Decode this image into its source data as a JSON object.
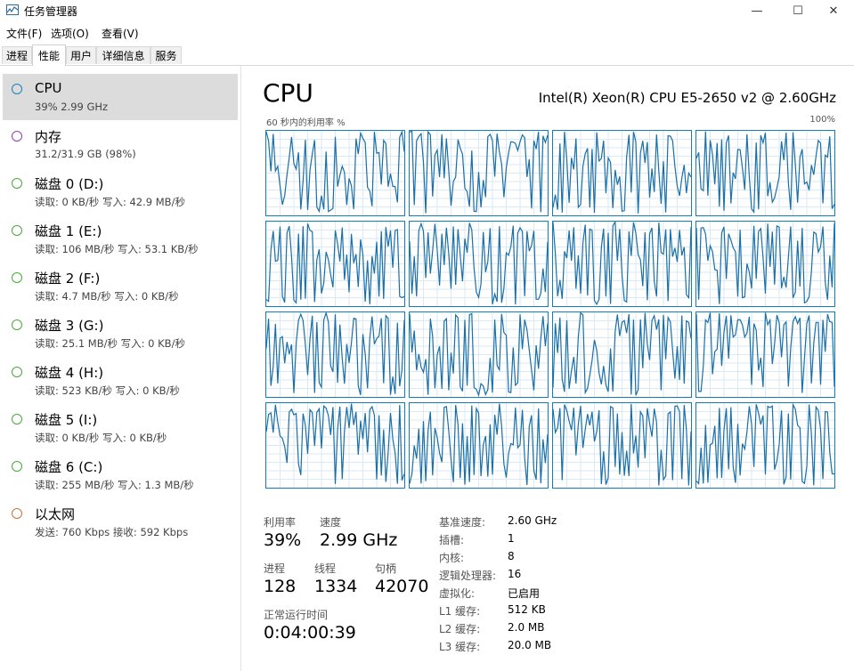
{
  "window": {
    "title": "任务管理器",
    "minimize_glyph": "—",
    "maximize_glyph": "☐",
    "close_glyph": "✕"
  },
  "menu": [
    "文件(F)",
    "选项(O)",
    "查看(V)"
  ],
  "tabs": [
    {
      "label": "进程",
      "active": false
    },
    {
      "label": "性能",
      "active": true
    },
    {
      "label": "用户",
      "active": false
    },
    {
      "label": "详细信息",
      "active": false
    },
    {
      "label": "服务",
      "active": false
    }
  ],
  "sidebar": {
    "items": [
      {
        "title": "CPU",
        "sub": "39% 2.99 GHz",
        "color": "#1a7fc1",
        "selected": true
      },
      {
        "title": "内存",
        "sub": "31.2/31.9 GB (98%)",
        "color": "#8e3fb3",
        "selected": false
      },
      {
        "title": "磁盘 0 (D:)",
        "sub": "读取: 0 KB/秒 写入: 42.9 MB/秒",
        "color": "#4aa73a",
        "selected": false
      },
      {
        "title": "磁盘 1 (E:)",
        "sub": "读取: 106 MB/秒 写入: 53.1 KB/秒",
        "color": "#4aa73a",
        "selected": false
      },
      {
        "title": "磁盘 2 (F:)",
        "sub": "读取: 4.7 MB/秒 写入: 0 KB/秒",
        "color": "#4aa73a",
        "selected": false
      },
      {
        "title": "磁盘 3 (G:)",
        "sub": "读取: 25.1 MB/秒 写入: 0 KB/秒",
        "color": "#4aa73a",
        "selected": false
      },
      {
        "title": "磁盘 4 (H:)",
        "sub": "读取: 523 KB/秒 写入: 0 KB/秒",
        "color": "#4aa73a",
        "selected": false
      },
      {
        "title": "磁盘 5 (I:)",
        "sub": "读取: 0 KB/秒 写入: 0 KB/秒",
        "color": "#4aa73a",
        "selected": false
      },
      {
        "title": "磁盘 6 (C:)",
        "sub": "读取: 255 MB/秒 写入: 1.3 MB/秒",
        "color": "#4aa73a",
        "selected": false
      },
      {
        "title": "以太网",
        "sub": "发送: 760 Kbps 接收: 592 Kbps",
        "color": "#c8733a",
        "selected": false
      }
    ]
  },
  "main": {
    "title": "CPU",
    "model": "Intel(R) Xeon(R) CPU E5-2650 v2 @ 2.60GHz",
    "graph_label": "60 秒内的利用率 %",
    "graph_max": "100%",
    "line_color": "#1a6fa8",
    "grid_color": "#d9e9f5",
    "cores": 16
  },
  "stats": {
    "util_label": "利用率",
    "util_value": "39%",
    "speed_label": "速度",
    "speed_value": "2.99 GHz",
    "proc_label": "进程",
    "proc_value": "128",
    "thread_label": "线程",
    "thread_value": "1334",
    "handle_label": "句柄",
    "handle_value": "42070",
    "uptime_label": "正常运行时间",
    "uptime_value": "0:04:00:39"
  },
  "specs": [
    {
      "k": "基准速度:",
      "v": "2.60 GHz"
    },
    {
      "k": "插槽:",
      "v": "1"
    },
    {
      "k": "内核:",
      "v": "8"
    },
    {
      "k": "逻辑处理器:",
      "v": "16"
    },
    {
      "k": "虚拟化:",
      "v": "已启用"
    },
    {
      "k": "L1 缓存:",
      "v": "512 KB"
    },
    {
      "k": "L2 缓存:",
      "v": "2.0 MB"
    },
    {
      "k": "L3 缓存:",
      "v": "20.0 MB"
    }
  ]
}
